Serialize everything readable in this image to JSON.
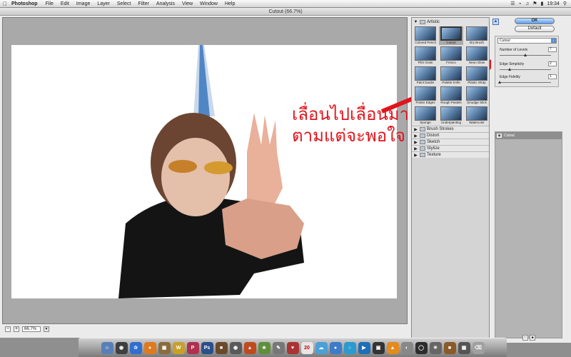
{
  "menubar": {
    "app_name": "Photoshop",
    "items": [
      "File",
      "Edit",
      "Image",
      "Layer",
      "Select",
      "Filter",
      "Analysis",
      "View",
      "Window",
      "Help"
    ],
    "clock": "19:34"
  },
  "window": {
    "title": "Cutout (66.7%)"
  },
  "annotation": {
    "line1": "เลื่อนไปเลื่อนมา",
    "line2": "ตามแต่จะพอใจ"
  },
  "statusbar": {
    "zoom_value": "66.7%",
    "minus": "−",
    "plus": "+"
  },
  "filter_browser": {
    "open_category": "Artistic",
    "filters": [
      {
        "label": "Colored Pencil",
        "selected": false
      },
      {
        "label": "Cutout",
        "selected": true
      },
      {
        "label": "Dry Brush",
        "selected": false
      },
      {
        "label": "Film Grain",
        "selected": false
      },
      {
        "label": "Fresco",
        "selected": false
      },
      {
        "label": "Neon Glow",
        "selected": false
      },
      {
        "label": "Paint Daubs",
        "selected": false
      },
      {
        "label": "Palette Knife",
        "selected": false
      },
      {
        "label": "Plastic Wrap",
        "selected": false
      },
      {
        "label": "Poster Edges",
        "selected": false
      },
      {
        "label": "Rough Pastels",
        "selected": false
      },
      {
        "label": "Smudge Stick",
        "selected": false
      },
      {
        "label": "Sponge",
        "selected": false
      },
      {
        "label": "Underpainting",
        "selected": false
      },
      {
        "label": "Watercolor",
        "selected": false
      }
    ],
    "collapsed_categories": [
      "Brush Strokes",
      "Distort",
      "Sketch",
      "Stylize",
      "Texture"
    ]
  },
  "settings": {
    "ok_label": "OK",
    "default_label": "Default",
    "filter_select": "Cutout",
    "params": [
      {
        "label": "Number of Levels",
        "value": "7",
        "level": 0.5
      },
      {
        "label": "Edge Simplicity",
        "value": "2",
        "level": 0.2
      },
      {
        "label": "Edge Fidelity",
        "value": "1",
        "level": 0.0
      }
    ]
  },
  "layers": {
    "items": [
      {
        "label": "Cutout"
      }
    ]
  },
  "colors": {
    "annotation_red": "#e0141c",
    "ok_blue": "#5c9be8"
  }
}
